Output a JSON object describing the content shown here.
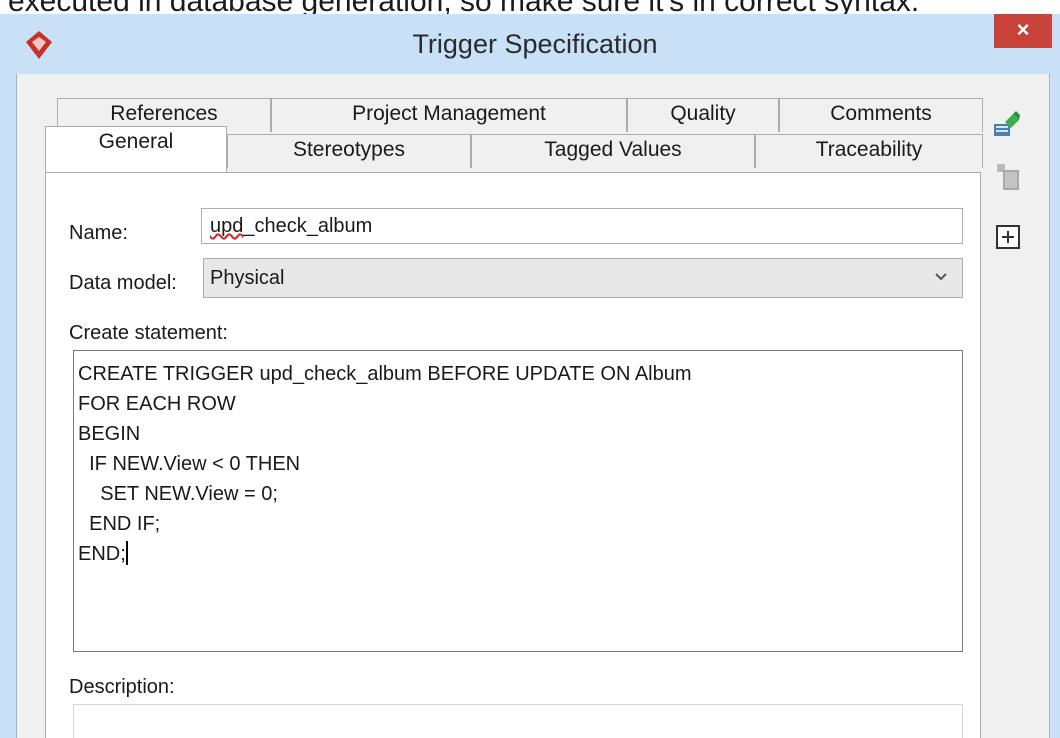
{
  "background_text": "executed in database generation, so make sure it's in correct syntax.",
  "window": {
    "title": "Trigger Specification",
    "close_glyph": "×",
    "app_icon": "visual-paradigm-logo-icon"
  },
  "tabs": {
    "back_row": [
      "References",
      "Project Management",
      "Quality",
      "Comments"
    ],
    "front_row": [
      "General",
      "Stereotypes",
      "Tagged Values",
      "Traceability"
    ],
    "active": "General"
  },
  "form": {
    "name_label": "Name:",
    "name_value_underlined": "upd",
    "name_value_rest": "_check_album",
    "data_model_label": "Data model:",
    "data_model_value": "Physical",
    "create_statement_label": "Create statement:",
    "create_statement_lines": [
      "CREATE TRIGGER upd_check_album BEFORE UPDATE ON Album",
      "FOR EACH ROW",
      "BEGIN",
      "  IF NEW.View < 0 THEN",
      "    SET NEW.View = 0;",
      "  END IF;",
      "END;"
    ],
    "description_label": "Description:"
  },
  "side_toolbar": [
    "edit-pin-icon",
    "disabled-grid-icon",
    "add-box-icon"
  ],
  "colors": {
    "frame": "#c9e1f7",
    "close": "#c7433a",
    "logo": "#c8312a"
  }
}
